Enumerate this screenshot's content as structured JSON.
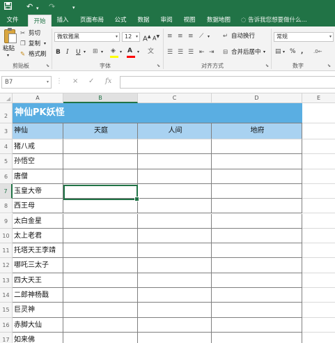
{
  "quick_access": {
    "save_icon": "save-icon",
    "undo_icon": "undo-icon",
    "redo_icon": "redo-icon",
    "customize_icon": "customize-icon"
  },
  "ribbon_tabs": [
    "文件",
    "开始",
    "插入",
    "页面布局",
    "公式",
    "数据",
    "审阅",
    "视图",
    "数据地图"
  ],
  "active_tab": "开始",
  "tell_me": "告诉我您想要做什么...",
  "clipboard": {
    "paste": "粘贴",
    "cut": "剪切",
    "copy": "复制",
    "format_painter": "格式刷",
    "label": "剪贴板"
  },
  "font": {
    "name": "微软雅黑",
    "size": "12",
    "bold": "B",
    "italic": "I",
    "underline": "U",
    "label": "字体",
    "grow": "A",
    "shrink": "A",
    "font_color": "A"
  },
  "alignment": {
    "wrap_text": "自动换行",
    "merge_center": "合并后居中",
    "label": "对齐方式"
  },
  "number": {
    "format": "常规",
    "percent": "%",
    "comma": ",",
    "label": "数字"
  },
  "formula_bar": {
    "name_box": "B7",
    "cancel": "×",
    "enter": "✓",
    "fx": "fx",
    "value": ""
  },
  "columns": [
    "A",
    "B",
    "C",
    "D",
    "E"
  ],
  "selected_column": "B",
  "selected_row": "7",
  "sheet": {
    "title": "神仙PK妖怪",
    "headers": [
      "神仙",
      "天庭",
      "人间",
      "地府"
    ],
    "row_numbers": [
      "2",
      "3",
      "4",
      "5",
      "6",
      "7",
      "8",
      "9",
      "10",
      "11",
      "12",
      "13",
      "14",
      "15",
      "16",
      "17"
    ],
    "names": [
      "猪八戒",
      "孙悟空",
      "唐僧",
      "玉皇大帝",
      "西王母",
      "太白金星",
      "太上老君",
      "托塔天王李靖",
      "哪吒三太子",
      "四大天王",
      "二郎神杨戬",
      "巨灵神",
      "赤脚大仙",
      "如来佛"
    ]
  },
  "colors": {
    "brand": "#217346",
    "title_fill": "#5aaee2",
    "header_fill": "#a9d2f1"
  }
}
